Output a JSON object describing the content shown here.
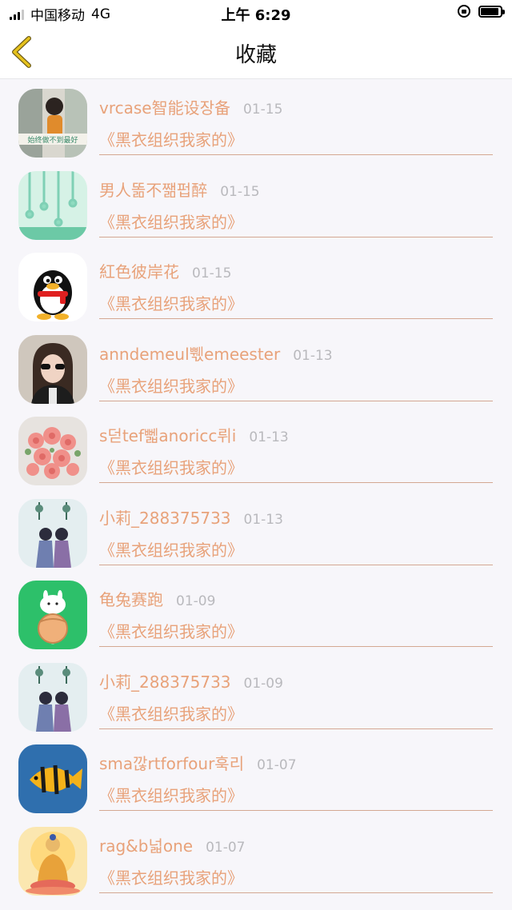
{
  "status_bar": {
    "carrier": "中国移动",
    "network": "4G",
    "time": "上午 6:29"
  },
  "nav": {
    "title": "收藏",
    "back_icon": "chevron-left-icon",
    "accent": "#e6c21c"
  },
  "colors": {
    "text_accent": "#e8a27a",
    "time_gray": "#b9b9bd",
    "divider": "#d4a892"
  },
  "favorites": [
    {
      "name": "vrcase智能设장备",
      "time": "01-15",
      "content": "《黑衣组织我家的》",
      "avatar": "photo-girl"
    },
    {
      "name": "男人똚不쨂펍醉",
      "time": "01-15",
      "content": "《黑衣组织我家的》",
      "avatar": "mint-raindrops"
    },
    {
      "name": "紅色彼岸花",
      "time": "01-15",
      "content": "《黑衣组织我家的》",
      "avatar": "qq-penguin"
    },
    {
      "name": "anndemeul쀇emeester",
      "time": "01-13",
      "content": "《黑衣组织我家的》",
      "avatar": "girl-sunglasses"
    },
    {
      "name": "s덛tef뻷anoricc뤼i",
      "time": "01-13",
      "content": "《黑衣组织我家的》",
      "avatar": "rose-bouquet"
    },
    {
      "name": "小莉_288375733",
      "time": "01-13",
      "content": "《黑衣组织我家的》",
      "avatar": "anime-couple"
    },
    {
      "name": "龟兔赛跑",
      "time": "01-09",
      "content": "《黑衣组织我家的》",
      "avatar": "green-bunny"
    },
    {
      "name": "小莉_288375733",
      "time": "01-09",
      "content": "《黑衣组织我家的》",
      "avatar": "anime-couple"
    },
    {
      "name": "sma깒rtforfour훅리",
      "time": "01-07",
      "content": "《黑衣组织我家的》",
      "avatar": "tropical-fish"
    },
    {
      "name": "rag&b넓one",
      "time": "01-07",
      "content": "《黑衣组织我家的》",
      "avatar": "buddha"
    }
  ]
}
